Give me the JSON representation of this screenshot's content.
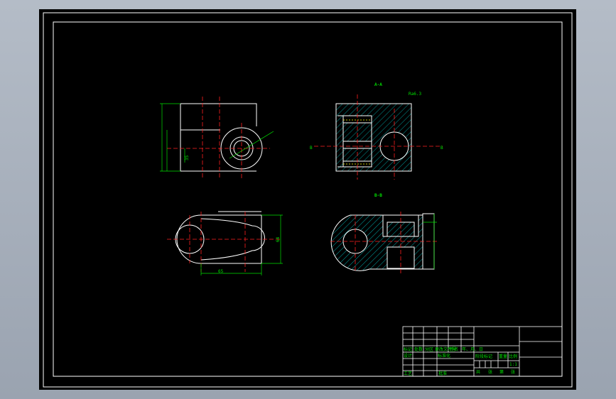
{
  "sheet": {
    "section_labels": {
      "a": "A-A",
      "b": "B-B"
    },
    "roughness": "Ra6.3",
    "dims": {
      "d1": "35",
      "d2": "65",
      "d3": "64",
      "cut_a": "B",
      "cut_b": "B",
      "cut_c": "A"
    },
    "title_block": {
      "col1": [
        "标记",
        "设计",
        "工艺"
      ],
      "col2": [
        "处数",
        "分区"
      ],
      "col3": [
        "更改文件号",
        "标准化",
        "批准"
      ],
      "col4": [
        "签名",
        "年、月、日"
      ],
      "stage": "阶段标记",
      "weight": "重量",
      "scale": "比例",
      "scale_value": "1:1",
      "sheets": [
        "共",
        "张",
        "第",
        "张"
      ]
    }
  },
  "colors": {
    "outline": "#ffffff",
    "center": "#ff2020",
    "dim": "#00e000",
    "hatch": "#00c8c8",
    "hidden": "#ffff00"
  }
}
